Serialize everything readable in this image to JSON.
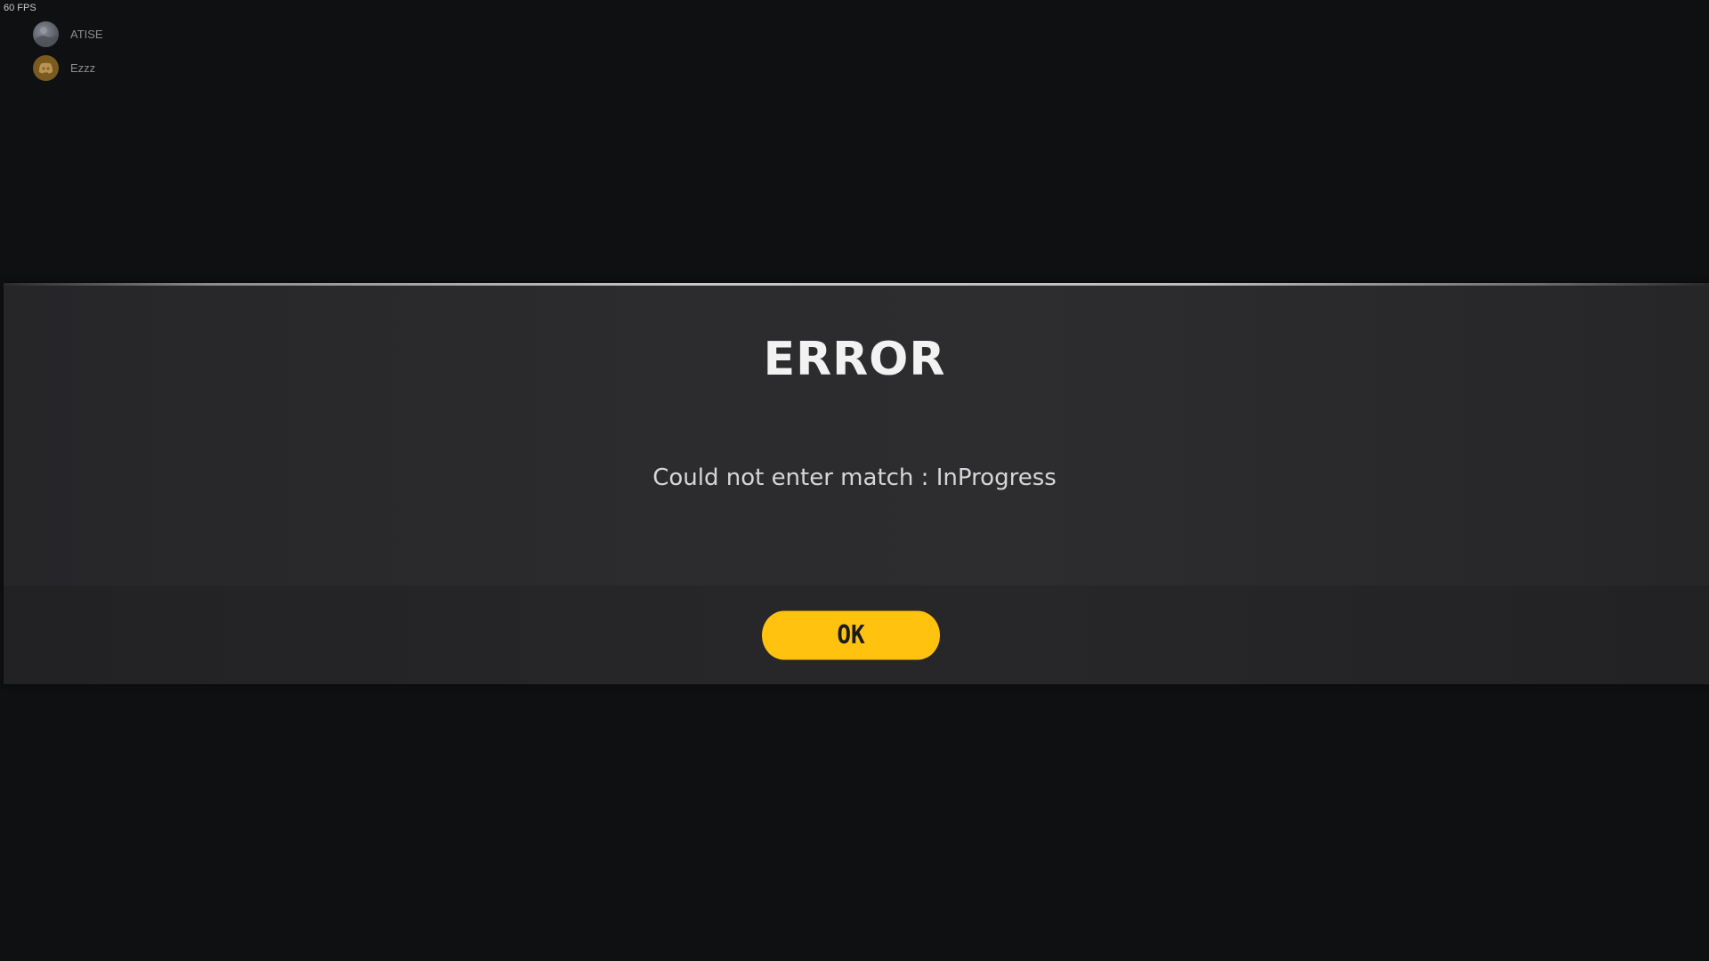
{
  "overlay": {
    "fps_text": "60 FPS"
  },
  "party": {
    "members": [
      {
        "name": "ATISE",
        "avatar_icon": "profile-picture"
      },
      {
        "name": "Ezzz",
        "avatar_icon": "discord-icon"
      }
    ]
  },
  "dialog": {
    "title": "ERROR",
    "message": "Could not enter match : InProgress",
    "ok_label": "OK"
  },
  "colors": {
    "background": "#0f1012",
    "dialog": "#2c2c2e",
    "accent": "#ffc20e",
    "title_text": "#f2f2f2"
  }
}
